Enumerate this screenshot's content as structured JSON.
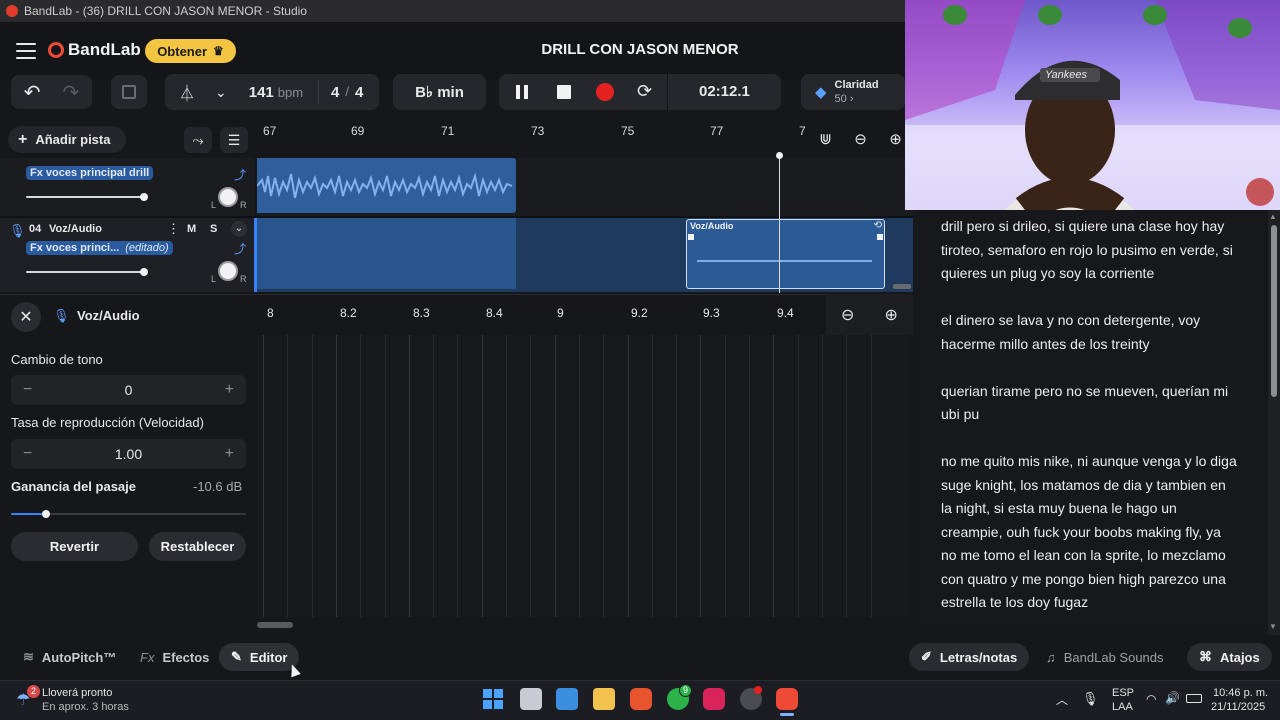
{
  "window": {
    "title": "BandLab - (36) DRILL CON JASON MENOR - Studio"
  },
  "header": {
    "brand": "BandLab",
    "upgrade_label": "Obtener",
    "song_title": "DRILL CON JASON MENOR"
  },
  "toolbar": {
    "bpm_value": "141",
    "bpm_unit": "bpm",
    "time_sig_num": "4",
    "time_sig_sep": "/",
    "time_sig_den": "4",
    "key": "B♭ min",
    "time": "02:12.1",
    "clarity_label": "Claridad",
    "clarity_value": "50 ›"
  },
  "tracks_header": {
    "add_track_label": "Añadir pista"
  },
  "ruler": {
    "marks": [
      "67",
      "69",
      "71",
      "73",
      "75",
      "77",
      "7"
    ]
  },
  "tracks": [
    {
      "effect": "Fx voces principal drill"
    },
    {
      "number": "04",
      "name": "Voz/Audio",
      "mute": "M",
      "solo": "S",
      "effect": "Fx voces princi...",
      "effect_state": "(editado)",
      "clip_label": "Voz/Audio"
    }
  ],
  "editor": {
    "track_name": "Voz/Audio",
    "ruler_marks": [
      "8",
      "8.2",
      "8.3",
      "8.4",
      "9",
      "9.2",
      "9.3",
      "9.4"
    ],
    "pitch_label": "Cambio de tono",
    "pitch_value": "0",
    "rate_label": "Tasa de reproducción (Velocidad)",
    "rate_value": "1.00",
    "gain_label": "Ganancia del pasaje",
    "gain_value": "-10.6 dB",
    "gain_level": 0.15,
    "revert_label": "Revertir",
    "reset_label": "Restablecer",
    "minus": "−",
    "plus": "+"
  },
  "bottom_tabs": {
    "autopitch": "AutoPitch™",
    "effects_prefix": "Fx",
    "effects": "Efectos",
    "editor": "Editor",
    "lyrics": "Letras/notas",
    "sounds": "BandLab Sounds",
    "shortcuts": "Atajos"
  },
  "lyrics": [
    "drill pero si drileo, si quiere una clase hoy hay tiroteo, semaforo en rojo lo pusimo en verde, si quieres un plug yo soy la corriente",
    "el dinero se lava y no con detergente, voy hacerme millo antes de los treinty",
    "querian tirame pero no se mueven, querían mi ubi pu",
    "no me quito mis nike, ni aunque venga y lo diga suge knight, los matamos de dia y tambien en la night, si esta muy buena le hago un creampie, ouh fuck your boobs making fly, ya no me tomo el lean con la sprite, lo mezclamo con quatro y me pongo bien high parezco una estrella te los doy fugaz"
  ],
  "webcam": {
    "cap_text": "Yankees"
  },
  "taskbar": {
    "weather_badge": "2",
    "weather_title": "Lloverá pronto",
    "weather_sub": "En aprox. 3 horas",
    "whatsapp_badge": "9",
    "lang_top": "ESP",
    "lang_bottom": "LAA",
    "time": "10:46 p. m.",
    "date": "21/11/2025"
  },
  "colors": {
    "accent": "#3b82f6",
    "brand_red": "#ef4a35",
    "upgrade": "#f4c542",
    "record": "#e52222"
  }
}
